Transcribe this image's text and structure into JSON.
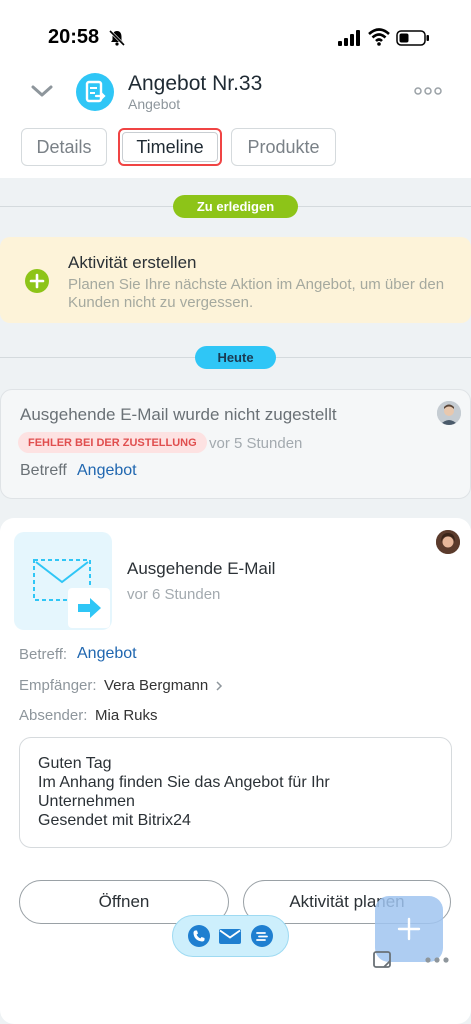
{
  "status_bar": {
    "time": "20:58"
  },
  "header": {
    "title": "Angebot Nr.33",
    "subtitle": "Angebot",
    "tabs": [
      {
        "label": "Details"
      },
      {
        "label": "Timeline"
      },
      {
        "label": "Produkte"
      }
    ]
  },
  "timeline": {
    "todo_label": "Zu erledigen",
    "today_label": "Heute",
    "activity": {
      "title": "Aktivität erstellen",
      "description": "Planen Sie Ihre nächste Aktion im Angebot, um über den Kunden nicht zu vergessen."
    },
    "failed_email": {
      "title": "Ausgehende E-Mail wurde nicht zugestellt",
      "error_badge": "FEHLER BEI DER ZUSTELLUNG",
      "time": "vor 5 Stunden",
      "subject_label": "Betreff",
      "subject_value": "Angebot"
    },
    "email": {
      "title": "Ausgehende E-Mail",
      "time": "vor 6 Stunden",
      "subject_label": "Betreff:",
      "subject_value": "Angebot",
      "recipient_label": "Empfänger:",
      "recipient_value": "Vera Bergmann",
      "sender_label": "Absender:",
      "sender_value": "Mia Ruks",
      "message_lines": [
        "Guten Tag",
        "Im Anhang finden Sie das Angebot für Ihr",
        "Unternehmen",
        "Gesendet mit Bitrix24"
      ],
      "open_button": "Öffnen",
      "plan_button": "Aktivität planen"
    }
  },
  "colors": {
    "accent_blue": "#2fc6f6",
    "accent_green": "#8dc418",
    "link": "#2067b0",
    "error": "#e04e4e"
  }
}
